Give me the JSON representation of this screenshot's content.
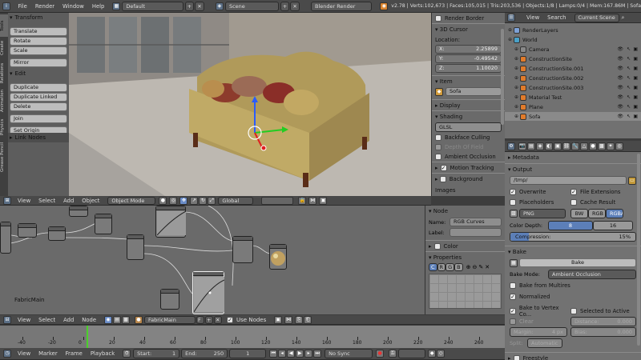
{
  "topbar": {
    "menus": [
      "File",
      "Render",
      "Window",
      "Help"
    ],
    "layout": "Default",
    "scene": "Scene",
    "engine": "Blender Render",
    "stats": "v2.78 | Verts:102,673 | Faces:105,015 | Tris:203,536 | Objects:1/8 | Lamps:0/4 | Mem:167.86M | Sofa"
  },
  "toolshelf": {
    "tabs": [
      "Tools",
      "Create",
      "Relations",
      "Animation",
      "Physics",
      "Grease Pencil"
    ],
    "transform_title": "Transform",
    "transform_buttons": [
      "Translate",
      "Rotate",
      "Scale"
    ],
    "mirror": "Mirror",
    "edit_title": "Edit",
    "edit_buttons": [
      "Duplicate",
      "Duplicate Linked",
      "Delete"
    ],
    "join": "Join",
    "set_origin": "Set Origin",
    "link_nodes": "Link Nodes"
  },
  "viewport_header": {
    "menus": [
      "View",
      "Select",
      "Add",
      "Object"
    ],
    "mode": "Object Mode",
    "orientation": "Global"
  },
  "npanel": {
    "render_border": "Render Border",
    "cursor_title": "3D Cursor",
    "location": "Location:",
    "x_label": "X:",
    "x": "2.25899",
    "y_label": "Y:",
    "y": "-0.49542",
    "z_label": "Z:",
    "z": "1.10020",
    "item_title": "Item",
    "object_name": "Sofa",
    "display": "Display",
    "shading": "Shading",
    "shading_mode": "GLSL",
    "backface": "Backface Culling",
    "dof": "Depth Of Field",
    "ao": "Ambient Occlusion",
    "motion": "Motion Tracking",
    "bg_images": "Background Images"
  },
  "node_header": {
    "menus": [
      "View",
      "Select",
      "Add",
      "Node"
    ],
    "material": "FabricMain",
    "use_nodes": "Use Nodes"
  },
  "node_editor": {
    "material_label": "FabricMain"
  },
  "node_panel": {
    "title": "Node",
    "name_label": "Name:",
    "name": "RGB Curves",
    "label_label": "Label:",
    "color": "Color",
    "properties": "Properties",
    "channels": [
      "C",
      "R",
      "G",
      "B"
    ]
  },
  "outliner": {
    "menus": [
      "View",
      "Search"
    ],
    "filter": "Current Scene",
    "items": [
      "RenderLayers",
      "World",
      "Camera",
      "ConstructionSite",
      "ConstructionSite.001",
      "ConstructionSite.002",
      "ConstructionSite.003",
      "Material Test",
      "Plane",
      "Sofa"
    ]
  },
  "properties": {
    "metadata": "Metadata",
    "output": "Output",
    "path": "/tmp/",
    "overwrite": "Overwrite",
    "file_ext": "File Extensions",
    "placeholders": "Placeholders",
    "cache_result": "Cache Result",
    "format": "PNG",
    "bw": "BW",
    "rgb": "RGB",
    "rgba": "RGBA",
    "color_depth": "Color Depth:",
    "depth_8": "8",
    "depth_16": "16",
    "compression": "Compression:",
    "compression_value": "15%",
    "compression_fraction": 0.15,
    "bake": "Bake",
    "bake_button": "Bake",
    "bake_mode_label": "Bake Mode:",
    "bake_mode": "Ambient Occlusion",
    "from_multires": "Bake from Multires",
    "normalized": "Normalized",
    "bake_vertex": "Bake to Vertex Co...",
    "selected_active": "Selected to Active",
    "clear": "Clear",
    "distance": "Distance:",
    "distance_value": "0.000",
    "margin": "Margin:",
    "margin_value": "4 px",
    "bias": "Bias:",
    "bias_value": "0.000",
    "split": "Split:",
    "split_mode": "Automatic",
    "freestyle": "Freestyle"
  },
  "timeline": {
    "ticks": [
      "-40",
      "-20",
      "0",
      "20",
      "40",
      "60",
      "80",
      "100",
      "120",
      "140",
      "160",
      "180",
      "200",
      "220",
      "240",
      "260"
    ],
    "menus": [
      "View",
      "Marker",
      "Frame",
      "Playback"
    ],
    "start_label": "Start:",
    "start": "1",
    "end_label": "End:",
    "end": "250",
    "current": "1",
    "sync": "No Sync"
  }
}
